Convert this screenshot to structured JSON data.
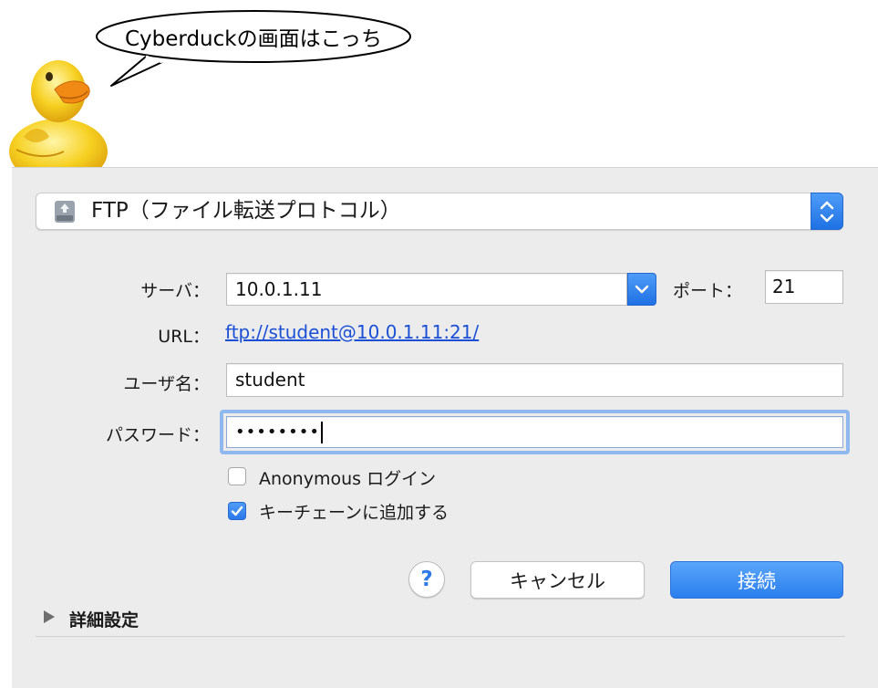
{
  "callout": {
    "text": "Cyberduckの画面はこっち"
  },
  "protocol": {
    "selected": "FTP（ファイル転送プロトコル）"
  },
  "form": {
    "server_label": "サーバ：",
    "server_value": "10.0.1.11",
    "port_label": "ポート：",
    "port_value": "21",
    "url_label": "URL：",
    "url_value": "ftp://student@10.0.1.11:21/",
    "username_label": "ユーザ名：",
    "username_value": "student",
    "password_label": "パスワード：",
    "password_mask": "••••••••"
  },
  "options": {
    "anonymous_label": "Anonymous ログイン",
    "anonymous_checked": false,
    "keychain_label": "キーチェーンに追加する",
    "keychain_checked": true
  },
  "buttons": {
    "help": "?",
    "cancel": "キャンセル",
    "connect": "接続"
  },
  "advanced": {
    "label": "詳細設定",
    "expanded": false
  },
  "colors": {
    "accent": "#2a7eed",
    "link": "#1a4fd6",
    "focus_ring": "#8fb8ee"
  },
  "icons": {
    "protocol": "ftp-drive-icon",
    "stepper": "chevron-up-down-icon",
    "server_dropdown": "chevron-down-icon",
    "checkmark": "checkmark-icon",
    "disclosure": "disclosure-triangle-right-icon",
    "mascot": "duck-mascot-icon"
  }
}
